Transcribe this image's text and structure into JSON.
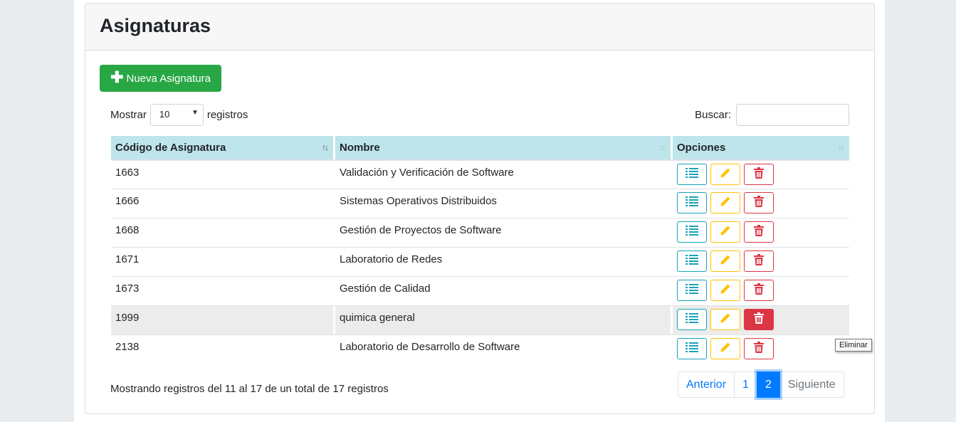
{
  "card": {
    "title": "Asignaturas"
  },
  "new_button": {
    "label": "Nueva Asignatura",
    "icon": "plus-icon"
  },
  "length": {
    "prefix": "Mostrar",
    "value": "10",
    "suffix": "registros"
  },
  "search": {
    "label": "Buscar:",
    "value": "",
    "placeholder": ""
  },
  "table": {
    "headers": [
      "Código de Asignatura",
      "Nombre",
      "Opciones"
    ],
    "rows": [
      {
        "code": "1663",
        "name": "Validación y Verificación de Software"
      },
      {
        "code": "1666",
        "name": "Sistemas Operativos Distribuidos"
      },
      {
        "code": "1668",
        "name": "Gestión de Proyectos de Software"
      },
      {
        "code": "1671",
        "name": "Laboratorio de Redes"
      },
      {
        "code": "1673",
        "name": "Gestión de Calidad"
      },
      {
        "code": "1999",
        "name": "quimica general"
      },
      {
        "code": "2138",
        "name": "Laboratorio de Desarrollo de Software"
      }
    ]
  },
  "tooltip": "Eliminar",
  "info": "Mostrando registros del 11 al 17 de un total de 17 registros",
  "pagination": {
    "prev": "Anterior",
    "pages": [
      "1",
      "2"
    ],
    "active_page": "2",
    "next": "Siguiente"
  },
  "colors": {
    "success": "#28a745",
    "info": "#17a2b8",
    "warning": "#ffc107",
    "danger": "#dc3545",
    "primary": "#007bff",
    "header_bg": "#bee5eb"
  }
}
